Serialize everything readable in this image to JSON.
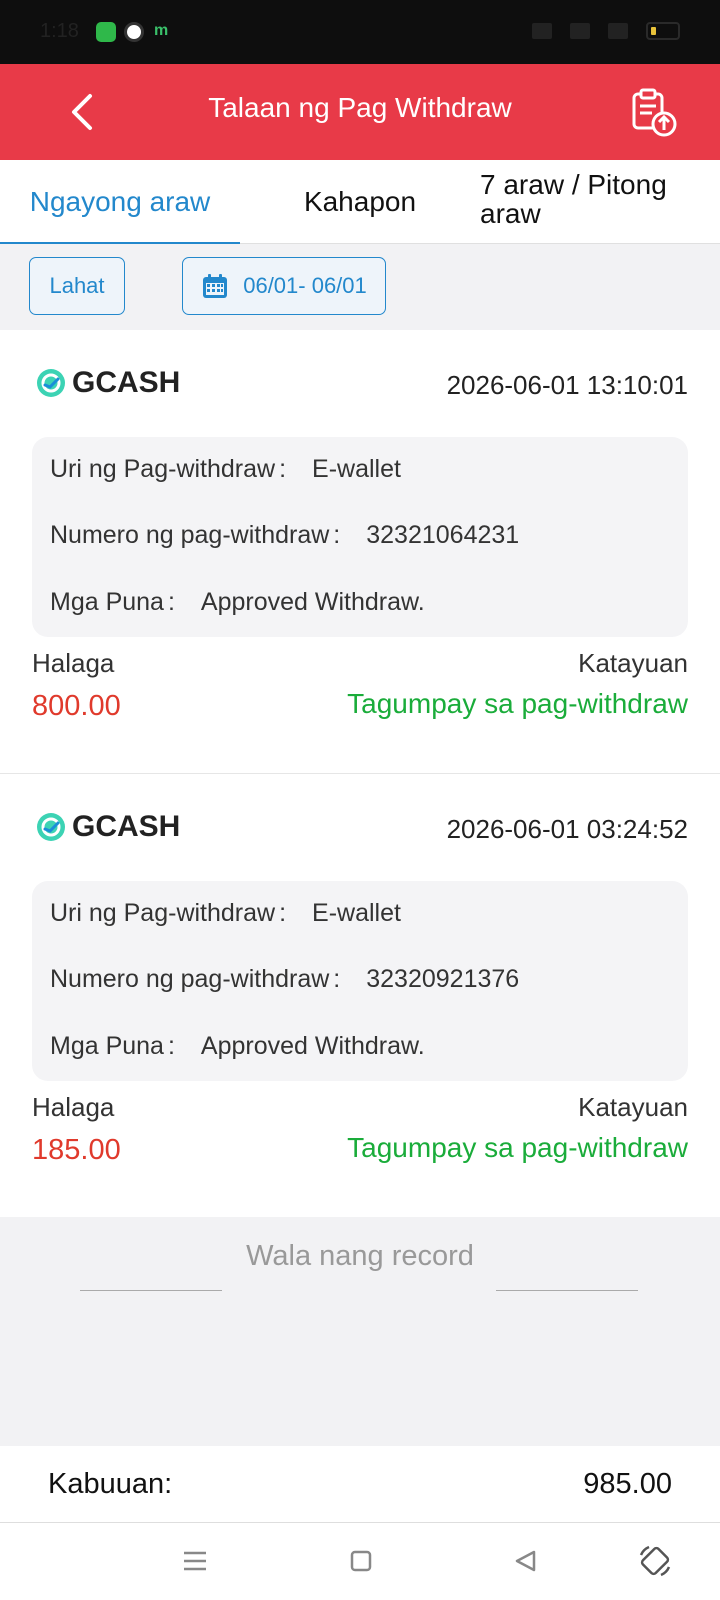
{
  "status_bar": {
    "time": "1:18",
    "apps": [
      "messages-app-icon",
      "settings-app-icon",
      "m-app-icon"
    ],
    "m_glyph": "m",
    "right_icons": [
      "vibrate-icon",
      "signal-icon",
      "signal-icon",
      "battery-icon"
    ]
  },
  "header": {
    "title": "Talaan ng Pag Withdraw",
    "background": "#e83a48",
    "back_icon": "chevron-left-icon",
    "action_icon": "clipboard-upload-icon"
  },
  "tabs": [
    {
      "label": "Ngayong araw",
      "active": true
    },
    {
      "label": "Kahapon",
      "active": false
    },
    {
      "label_line1": "7 araw / Pitong",
      "label_line2": "araw",
      "active": false
    }
  ],
  "filters": {
    "all_label": "Lahat",
    "date_range": "06/01- 06/01",
    "accent": "#2388cc"
  },
  "records": [
    {
      "method": "GCASH",
      "datetime": "2026-06-01 13:10:01",
      "type_label": "Uri ng Pag-withdraw",
      "type_value": "E-wallet",
      "number_label": "Numero ng pag-withdraw",
      "number_value": "32321064231",
      "remarks_label": "Mga Puna",
      "remarks_value": "Approved Withdraw.",
      "amount_label": "Halaga",
      "amount": "800.00",
      "status_label": "Katayuan",
      "status": "Tagumpay sa pag-withdraw"
    },
    {
      "method": "GCASH",
      "datetime": "2026-06-01 03:24:52",
      "type_label": "Uri ng Pag-withdraw",
      "type_value": "E-wallet",
      "number_label": "Numero ng pag-withdraw",
      "number_value": "32320921376",
      "remarks_label": "Mga Puna",
      "remarks_value": "Approved Withdraw.",
      "amount_label": "Halaga",
      "amount": "185.00",
      "status_label": "Katayuan",
      "status": "Tagumpay sa pag-withdraw"
    }
  ],
  "colon": ":",
  "no_more": "Wala nang record",
  "total": {
    "label": "Kabuuan:",
    "value": "985.00"
  },
  "colors": {
    "amount": "#e03a2c",
    "status_success": "#1aac3a"
  },
  "nav_bar": [
    "menu-icon",
    "home-square-icon",
    "back-triangle-icon",
    "rotate-icon"
  ]
}
